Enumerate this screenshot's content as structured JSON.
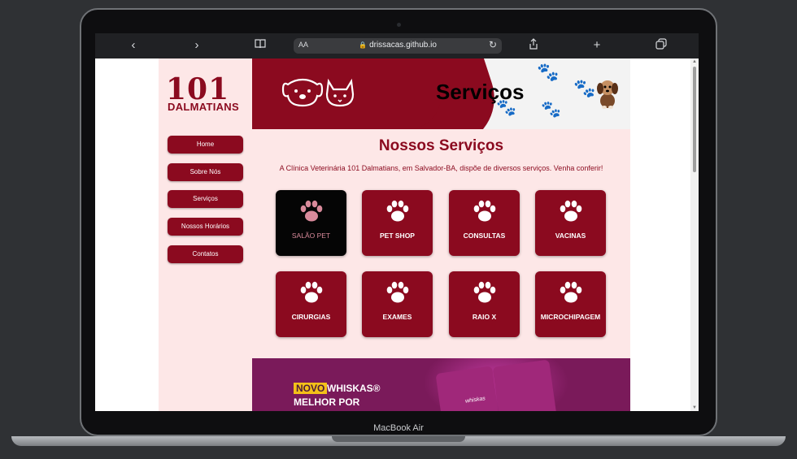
{
  "device": {
    "model_label": "MacBook Air"
  },
  "browser": {
    "url": "drissacas.github.io",
    "text_size_label": "AA",
    "icons": [
      "back-icon",
      "forward-icon",
      "bookmarks-icon",
      "lock-icon",
      "reload-icon",
      "share-icon",
      "new-tab-icon",
      "tabs-icon"
    ]
  },
  "site": {
    "logo": {
      "number": "101",
      "word": "DALMATIANS"
    },
    "banner": {
      "title": "Serviços"
    },
    "nav": [
      {
        "label": "Home"
      },
      {
        "label": "Sobre Nós"
      },
      {
        "label": "Serviços"
      },
      {
        "label": "Nossos Horários"
      },
      {
        "label": "Contatos"
      }
    ],
    "main": {
      "title": "Nossos Serviços",
      "description": "A Clínica Veterinária 101 Dalmatians, em Salvador-BA, dispõe de diversos serviços. Venha conferir!",
      "services": [
        {
          "label": "SALÃO PET",
          "active": true
        },
        {
          "label": "PET SHOP",
          "active": false
        },
        {
          "label": "CONSULTAS",
          "active": false
        },
        {
          "label": "VACINAS",
          "active": false
        },
        {
          "label": "CIRURGIAS",
          "active": false
        },
        {
          "label": "EXAMES",
          "active": false
        },
        {
          "label": "RAIO X",
          "active": false
        },
        {
          "label": "MICROCHIPAGEM",
          "active": false
        }
      ]
    },
    "ad": {
      "tag": "NOVO",
      "brand": "WHISKAS®",
      "line2": "MELHOR POR",
      "pack_label": "whiskas"
    }
  },
  "colors": {
    "brand_red": "#8b0a1f",
    "page_bg": "#fde7e7",
    "active_card": "#050505",
    "active_label": "#d98a9b"
  }
}
